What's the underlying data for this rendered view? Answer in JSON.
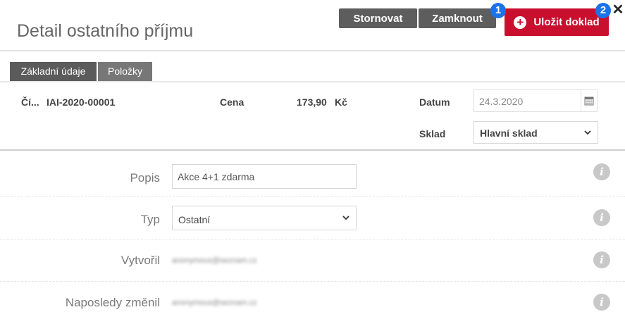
{
  "page": {
    "title": "Detail ostatního příjmu"
  },
  "toolbar": {
    "cancel_label": "Stornovat",
    "lock_label": "Zamknout",
    "save_label": "Uložit doklad",
    "badge1": "1",
    "badge2": "2",
    "close_glyph": "✕"
  },
  "tabs": [
    {
      "label": "Základní údaje",
      "active": true
    },
    {
      "label": "Položky",
      "active": false
    }
  ],
  "summary": {
    "number_label": "Čí...",
    "number_value": "IAI-2020-00001",
    "price_label": "Cena",
    "price_value": "173,90",
    "currency": "Kč",
    "date_label": "Datum",
    "date_value": "24.3.2020",
    "warehouse_label": "Sklad",
    "warehouse_value": "Hlavní sklad"
  },
  "form": {
    "description": {
      "label": "Popis",
      "value": "Akce 4+1 zdarma"
    },
    "type": {
      "label": "Typ",
      "value": "Ostatní"
    },
    "created_by": {
      "label": "Vytvořil",
      "value": "anonymous@seznam.cz"
    },
    "last_changed_by": {
      "label": "Naposledy změnil",
      "value": "anonymous@seznam.cz"
    },
    "info_glyph": "i"
  },
  "colors": {
    "save_button": "#c8102e",
    "dark_button": "#5d5d5d",
    "badge": "#1a73e8",
    "active_tab": "#5b5b5b"
  }
}
